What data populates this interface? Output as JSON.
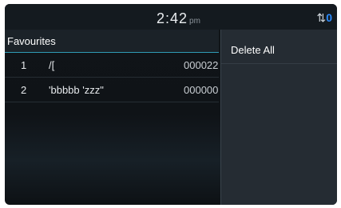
{
  "status_bar": {
    "time": "2:42",
    "ampm": "pm",
    "indicator_text": "0",
    "colors": {
      "accent": "#2b8cff",
      "divider": "#2f9bb5"
    }
  },
  "page": {
    "title": "Favourites"
  },
  "favourites": [
    {
      "index": "1",
      "name": "/[",
      "number": "000022"
    },
    {
      "index": "2",
      "name": "'bbbbb 'zzz\"",
      "number": "000000"
    }
  ],
  "menu": {
    "items": [
      "Delete All"
    ]
  }
}
